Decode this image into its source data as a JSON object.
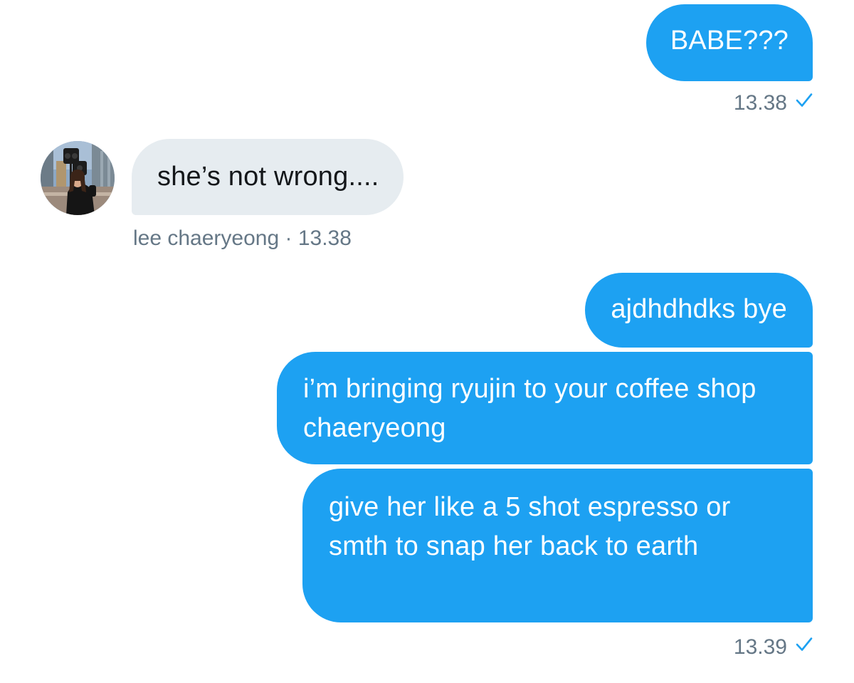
{
  "conversation": {
    "messages": [
      {
        "direction": "outgoing",
        "text": "BABE???",
        "timestamp": "13.38"
      },
      {
        "direction": "incoming",
        "text": "she’s not wrong....",
        "sender": "lee chaeryeong",
        "separator": "·",
        "timestamp": "13.38"
      },
      {
        "direction": "outgoing",
        "text": "ajdhdhdks bye"
      },
      {
        "direction": "outgoing",
        "text": "i’m bringing ryujin to your coffee shop chaeryeong"
      },
      {
        "direction": "outgoing",
        "text": "give her like a 5 shot espresso or smth to snap her back to earth",
        "timestamp": "13.39"
      }
    ]
  },
  "icons": {
    "read_receipt": "checkmark-icon",
    "avatar": "avatar"
  },
  "colors": {
    "outgoing_bubble": "#1da1f2",
    "incoming_bubble": "#e6ecf0",
    "meta_text": "#657786",
    "checkmark": "#1da1f2"
  }
}
